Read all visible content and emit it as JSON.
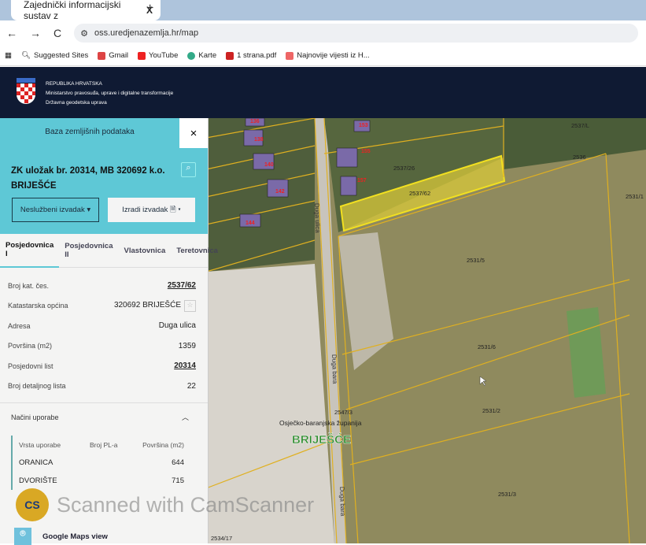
{
  "browser": {
    "tab_title": "Zajednički informacijski sustav z",
    "url": "oss.uredjenazemlja.hr/map",
    "bookmarks": [
      "Suggested Sites",
      "Gmail",
      "YouTube",
      "Karte",
      "1 strana.pdf",
      "Najnovije vijesti iz H..."
    ]
  },
  "header": {
    "line1": "REPUBLIKA HRVATSKA",
    "line2": "Ministarstvo pravosuđa, uprave i digitalne transformacije",
    "line3": "Državna geodetska uprava"
  },
  "panel": {
    "title": "Baza zemljišnih podataka",
    "close": "×",
    "heading": "ZK uložak br. 20314, MB 320692 k.o. BRIJEŠĆE",
    "btn_unofficial": "Neslužbeni izvadak ▾",
    "btn_create": "Izradi izvadak 🗎 ▾",
    "tabs": [
      "Posjedovnica I",
      "Posjedovnica II",
      "Vlastovnica",
      "Teretovnica"
    ],
    "rows": [
      {
        "label": "Broj kat. čes.",
        "value": "2537/62"
      },
      {
        "label": "Katastarska općina",
        "value": "320692 BRIJEŠĆE"
      },
      {
        "label": "Adresa",
        "value": "Duga ulica"
      },
      {
        "label": "Površina (m2)",
        "value": "1359"
      },
      {
        "label": "Posjedovni list",
        "value": "20314"
      },
      {
        "label": "Broj detaljnog lista",
        "value": "22"
      }
    ],
    "usage_title": "Načini uporabe",
    "usage_headers": [
      "Vrsta uporabe",
      "Broj PL-a",
      "Površina (m2)"
    ],
    "usage_rows": [
      {
        "type": "ORANICA",
        "pl": "",
        "area": "644"
      },
      {
        "type": "DVORIŠTE",
        "pl": "",
        "area": "715"
      }
    ],
    "google_maps": "Google Maps view"
  },
  "map": {
    "houses": [
      "136",
      "138",
      "140",
      "142",
      "144",
      "153",
      "155",
      "157"
    ],
    "parcels": [
      "2537/26",
      "2537/62",
      "2536",
      "2537/L",
      "2531/5",
      "2531/6",
      "2531/2",
      "2531/3",
      "2531/1",
      "2534/17",
      "2547/3"
    ],
    "streets": [
      "Duga ulica",
      "Duga bara",
      "Duga bara"
    ],
    "county": "Osječko-baranjska županija",
    "place": "BRIJEŠĆE"
  },
  "watermark": "Scanned with CamScanner",
  "colors": {
    "accent": "#5ec8d6",
    "header": "#0f1a33",
    "parcel_line": "#e8c020",
    "selected": "#e6d02a"
  }
}
